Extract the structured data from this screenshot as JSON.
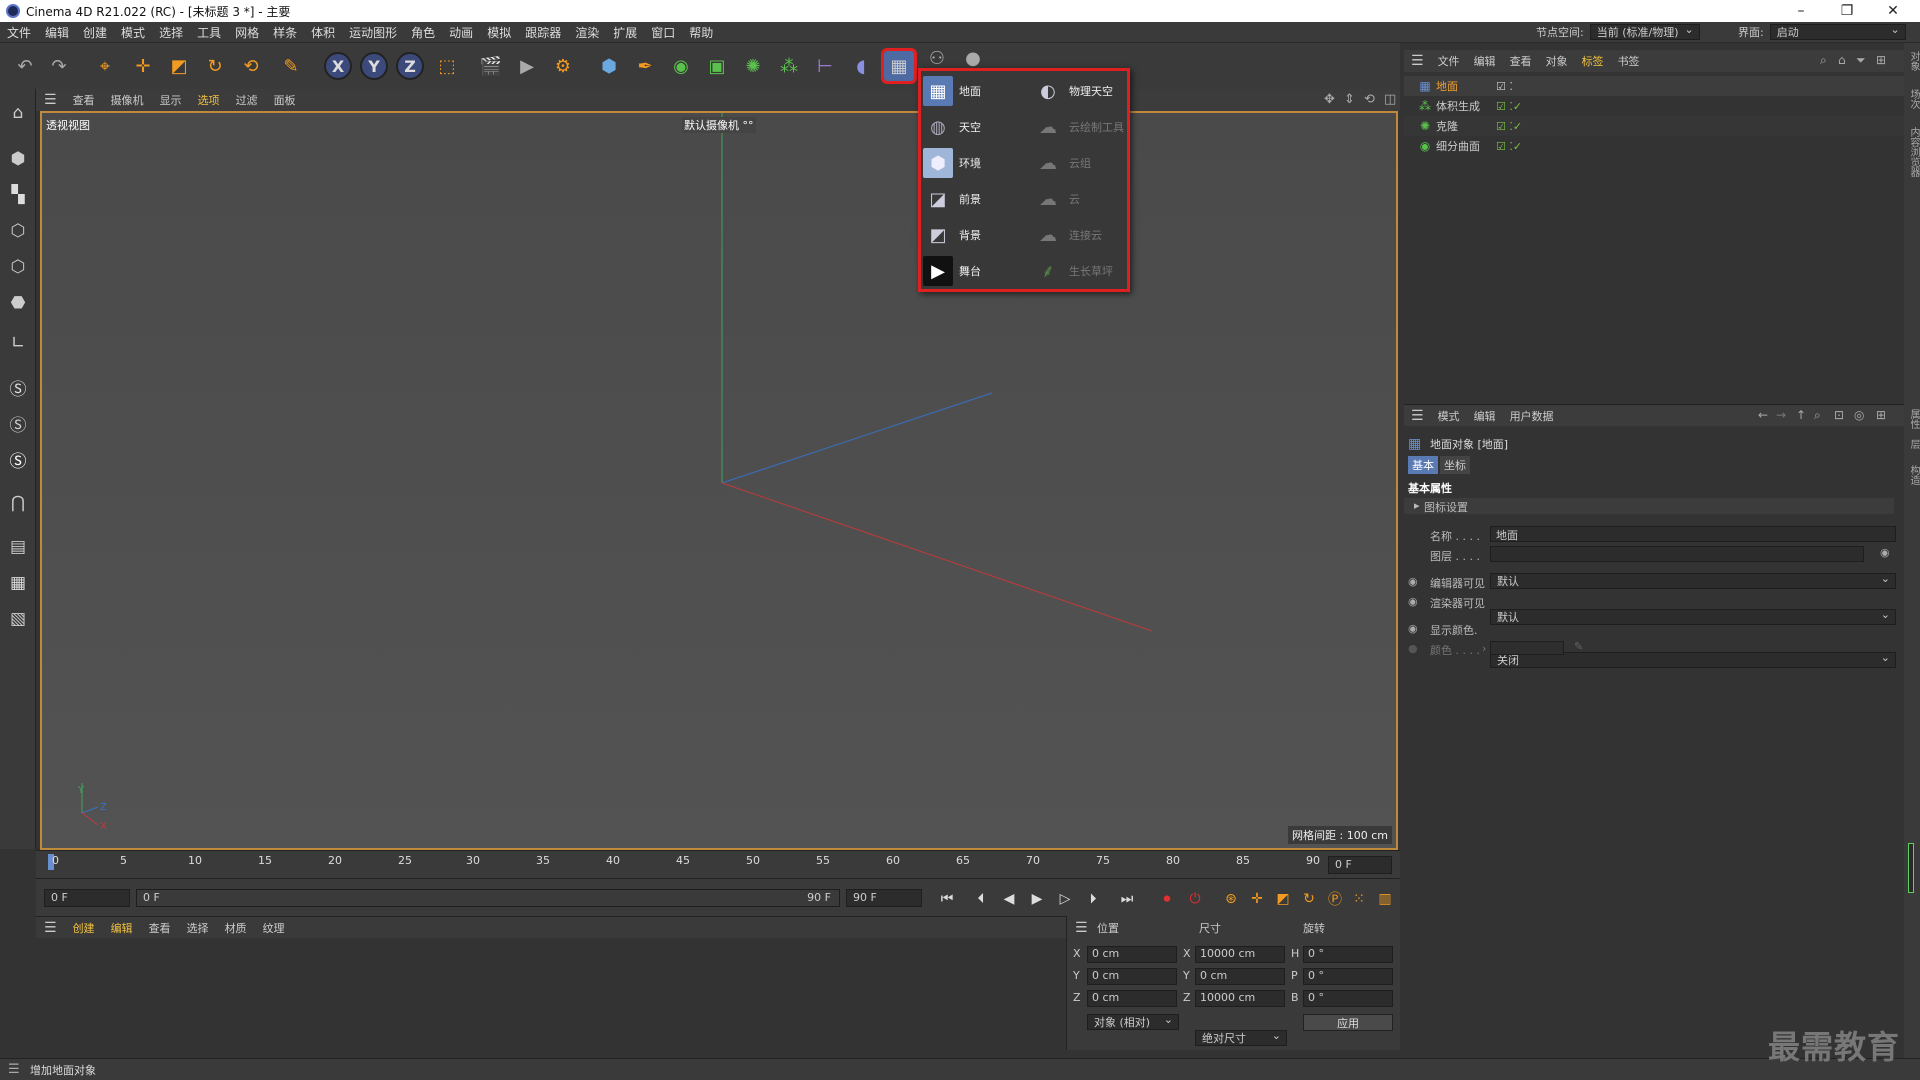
{
  "window": {
    "title": "Cinema 4D R21.022 (RC) - [未标题 3 *] - 主要",
    "controls": {
      "minimize": "–",
      "restore": "❐",
      "close": "✕"
    }
  },
  "menubar": {
    "items": [
      "文件",
      "编辑",
      "创建",
      "模式",
      "选择",
      "工具",
      "网格",
      "样条",
      "体积",
      "运动图形",
      "角色",
      "动画",
      "模拟",
      "跟踪器",
      "渲染",
      "扩展",
      "窗口",
      "帮助"
    ],
    "node_space_label": "节点空间:",
    "node_space_value": "当前 (标准/物理)",
    "layout_label": "界面:",
    "layout_value": "启动"
  },
  "toolbar": {
    "icons": [
      "undo-icon",
      "redo-icon",
      "select-icon",
      "move-icon",
      "scale-icon",
      "rotate-icon",
      "psr-icon",
      "live-select-icon",
      "x-axis",
      "y-axis",
      "z-axis",
      "coordinate-system-icon",
      "render-region-icon",
      "render-view-icon",
      "render-settings-icon",
      "cube-icon",
      "pen-icon",
      "subdivision-icon",
      "extrude-icon",
      "cloner-icon",
      "volume-icon",
      "measure-icon",
      "deformer-icon",
      "floor-icon",
      "camera-icon",
      "light-icon"
    ],
    "axis_x": "X",
    "axis_y": "Y",
    "axis_z": "Z"
  },
  "viewport": {
    "menu": [
      "查看",
      "摄像机",
      "显示",
      "选项",
      "过滤",
      "面板"
    ],
    "view_label": "透视视图",
    "camera_label": "默认摄像机 °°",
    "grid_spacing": "网格间距 : 100 cm"
  },
  "popup": {
    "left": [
      {
        "label": "地面",
        "icon": "floor-icon"
      },
      {
        "label": "天空",
        "icon": "sky-icon"
      },
      {
        "label": "环境",
        "icon": "environment-icon"
      },
      {
        "label": "前景",
        "icon": "foreground-icon"
      },
      {
        "label": "背景",
        "icon": "background-icon"
      },
      {
        "label": "舞台",
        "icon": "stage-icon"
      }
    ],
    "right": [
      {
        "label": "物理天空",
        "icon": "physical-sky-icon",
        "enabled": true
      },
      {
        "label": "云绘制工具",
        "icon": "cloud-tool-icon",
        "enabled": false
      },
      {
        "label": "云组",
        "icon": "cloud-group-icon",
        "enabled": false
      },
      {
        "label": "云",
        "icon": "cloud-icon",
        "enabled": false
      },
      {
        "label": "连接云",
        "icon": "connect-clouds-icon",
        "enabled": false
      },
      {
        "label": "生长草坪",
        "icon": "grass-icon",
        "enabled": false
      }
    ]
  },
  "timeline": {
    "ticks": [
      "0",
      "5",
      "10",
      "15",
      "20",
      "25",
      "30",
      "35",
      "40",
      "45",
      "50",
      "55",
      "60",
      "65",
      "70",
      "75",
      "80",
      "85",
      "90"
    ],
    "current_frame": "0 F"
  },
  "playbar": {
    "start": "0 F",
    "current": "0 F",
    "end_inner": "90 F",
    "end": "90 F"
  },
  "material_manager": {
    "menu": [
      "创建",
      "编辑",
      "查看",
      "选择",
      "材质",
      "纹理"
    ]
  },
  "coordinates": {
    "headers": [
      "位置",
      "尺寸",
      "旋转"
    ],
    "rows": [
      {
        "axis": "X",
        "pos": "0 cm",
        "size_axis": "X",
        "size": "10000 cm",
        "rot_axis": "H",
        "rot": "0 °"
      },
      {
        "axis": "Y",
        "pos": "0 cm",
        "size_axis": "Y",
        "size": "0 cm",
        "rot_axis": "P",
        "rot": "0 °"
      },
      {
        "axis": "Z",
        "pos": "0 cm",
        "size_axis": "Z",
        "size": "10000 cm",
        "rot_axis": "B",
        "rot": "0 °"
      }
    ],
    "mode_dropdown": "对象 (相对)",
    "size_dropdown": "绝对尺寸",
    "apply_button": "应用"
  },
  "object_manager": {
    "menu": [
      "文件",
      "编辑",
      "查看",
      "对象",
      "标签",
      "书签"
    ],
    "objects": [
      {
        "name": "地面",
        "selected": true,
        "icon": "floor-icon"
      },
      {
        "name": "体积生成",
        "selected": false,
        "icon": "volume-builder-icon"
      },
      {
        "name": "克隆",
        "selected": false,
        "icon": "cloner-icon"
      },
      {
        "name": "细分曲面",
        "selected": false,
        "icon": "subdivision-icon"
      }
    ]
  },
  "attribute_manager": {
    "menu": [
      "模式",
      "编辑",
      "用户数据"
    ],
    "object_title": "地面对象 [地面]",
    "tabs": [
      "基本",
      "坐标"
    ],
    "section": "基本属性",
    "subsection": "图标设置",
    "name_label": "名称 . . . .",
    "name_value": "地面",
    "layer_label": "图层 . . . .",
    "layer_value": "",
    "editor_visible_label": "编辑器可见",
    "editor_visible_value": "默认",
    "render_visible_label": "渲染器可见",
    "render_visible_value": "默认",
    "display_color_label": "显示颜色.",
    "display_color_value": "关闭",
    "color_label": "颜色 . . . ."
  },
  "right_strip": [
    "对象",
    "场次",
    "内容浏览器",
    "属性",
    "层",
    "构造"
  ],
  "status": {
    "text": "增加地面对象"
  },
  "watermark": "最需教育",
  "colors": {
    "accent_orange": "#f39b21",
    "highlight_red": "#e02020",
    "viewport_border": "#c08a3c",
    "selected_text": "#f0a030",
    "check_green": "#7ac142"
  }
}
